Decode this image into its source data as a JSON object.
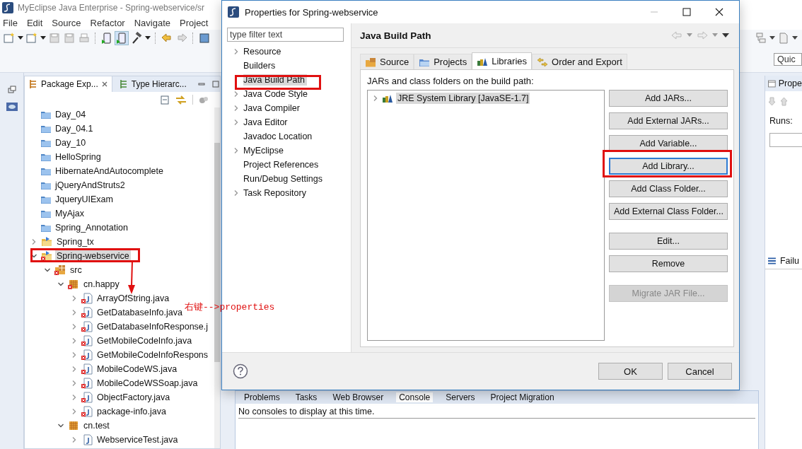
{
  "window": {
    "title": "MyEclipse Java Enterprise - Spring-webservice/sr"
  },
  "menu": [
    "File",
    "Edit",
    "Source",
    "Refactor",
    "Navigate",
    "Project"
  ],
  "quick_access": {
    "placeholder": "Quic"
  },
  "package_explorer": {
    "tabs": [
      {
        "label": "Package Exp...",
        "selected": true
      },
      {
        "label": "Type Hierarc...",
        "selected": false
      }
    ],
    "tree": [
      {
        "label": "Day_04",
        "kind": "closed-project",
        "selected": false
      },
      {
        "label": "Day_04.1",
        "kind": "closed-project",
        "selected": false
      },
      {
        "label": "Day_10",
        "kind": "closed-project",
        "selected": false
      },
      {
        "label": "HelloSpring",
        "kind": "closed-project",
        "selected": false
      },
      {
        "label": "HibernateAndAutocomplete",
        "kind": "closed-project",
        "selected": false
      },
      {
        "label": "jQueryAndStruts2",
        "kind": "closed-project",
        "selected": false
      },
      {
        "label": "JqueryUIExam",
        "kind": "closed-project",
        "selected": false
      },
      {
        "label": "MyAjax",
        "kind": "closed-project",
        "selected": false
      },
      {
        "label": "Spring_Annotation",
        "kind": "closed-project",
        "selected": false
      },
      {
        "label": "Spring_tx",
        "kind": "project",
        "expanded": false,
        "error": false,
        "selected": false
      },
      {
        "label": "Spring-webservice",
        "kind": "project",
        "expanded": true,
        "error": true,
        "selected": true,
        "children": [
          {
            "label": "src",
            "kind": "source-folder",
            "expanded": true,
            "error": true,
            "selected": false,
            "children": [
              {
                "label": "cn.happy",
                "kind": "package",
                "expanded": true,
                "error": true,
                "selected": false,
                "children": [
                  {
                    "label": "ArrayOfString.java",
                    "kind": "java-file",
                    "expanded": false,
                    "error": true,
                    "selected": false
                  },
                  {
                    "label": "GetDatabaseInfo.java",
                    "kind": "java-file",
                    "expanded": false,
                    "error": true,
                    "selected": false
                  },
                  {
                    "label": "GetDatabaseInfoResponse.j",
                    "kind": "java-file",
                    "expanded": false,
                    "error": true,
                    "selected": false
                  },
                  {
                    "label": "GetMobileCodeInfo.java",
                    "kind": "java-file",
                    "expanded": false,
                    "error": true,
                    "selected": false
                  },
                  {
                    "label": "GetMobileCodeInfoRespons",
                    "kind": "java-file",
                    "expanded": false,
                    "error": true,
                    "selected": false
                  },
                  {
                    "label": "MobileCodeWS.java",
                    "kind": "java-file",
                    "expanded": false,
                    "error": true,
                    "selected": false
                  },
                  {
                    "label": "MobileCodeWSSoap.java",
                    "kind": "java-file",
                    "expanded": false,
                    "error": true,
                    "selected": false
                  },
                  {
                    "label": "ObjectFactory.java",
                    "kind": "java-file",
                    "expanded": false,
                    "error": true,
                    "selected": false
                  },
                  {
                    "label": "package-info.java",
                    "kind": "java-file",
                    "expanded": false,
                    "error": true,
                    "selected": false
                  }
                ]
              },
              {
                "label": "cn.test",
                "kind": "package",
                "expanded": true,
                "error": false,
                "selected": false,
                "children": [
                  {
                    "label": "WebserviceTest.java",
                    "kind": "java-file",
                    "expanded": false,
                    "error": false,
                    "selected": false
                  }
                ]
              }
            ]
          }
        ]
      }
    ]
  },
  "right_panel": {
    "tab": "Prope",
    "runs_label": "Runs:",
    "failures_tab": "Failu"
  },
  "console": {
    "tabs": [
      {
        "label": "Problems",
        "selected": false
      },
      {
        "label": "Tasks",
        "selected": false
      },
      {
        "label": "Web Browser",
        "selected": false
      },
      {
        "label": "Console",
        "selected": true
      },
      {
        "label": "Servers",
        "selected": false
      },
      {
        "label": "Project Migration",
        "selected": false
      }
    ],
    "message": "No consoles to display at this time."
  },
  "dialog": {
    "title": "Properties for Spring-webservice",
    "filter": {
      "placeholder": "type filter text"
    },
    "categories": [
      {
        "label": "Resource",
        "expandable": true,
        "selected": false
      },
      {
        "label": "Builders",
        "expandable": false,
        "selected": false
      },
      {
        "label": "Java Build Path",
        "expandable": false,
        "selected": true
      },
      {
        "label": "Java Code Style",
        "expandable": true,
        "selected": false
      },
      {
        "label": "Java Compiler",
        "expandable": true,
        "selected": false
      },
      {
        "label": "Java Editor",
        "expandable": true,
        "selected": false
      },
      {
        "label": "Javadoc Location",
        "expandable": false,
        "selected": false
      },
      {
        "label": "MyEclipse",
        "expandable": true,
        "selected": false
      },
      {
        "label": "Project References",
        "expandable": false,
        "selected": false
      },
      {
        "label": "Run/Debug Settings",
        "expandable": false,
        "selected": false
      },
      {
        "label": "Task Repository",
        "expandable": true,
        "selected": false
      }
    ],
    "page_title": "Java Build Path",
    "tabs": [
      {
        "label": "Source",
        "selected": false
      },
      {
        "label": "Projects",
        "selected": false
      },
      {
        "label": "Libraries",
        "selected": true
      },
      {
        "label": "Order and Export",
        "selected": false
      }
    ],
    "list_label": "JARs and class folders on the build path:",
    "entries": [
      {
        "label": "JRE System Library [JavaSE-1.7]",
        "selected": true
      }
    ],
    "button_groups": [
      [
        {
          "label": "Add JARs...",
          "disabled": false,
          "focused": false
        },
        {
          "label": "Add External JARs...",
          "disabled": false,
          "focused": false
        },
        {
          "label": "Add Variable...",
          "disabled": false,
          "focused": false
        },
        {
          "label": "Add Library...",
          "disabled": false,
          "focused": true
        },
        {
          "label": "Add Class Folder...",
          "disabled": false,
          "focused": false
        },
        {
          "label": "Add External Class Folder...",
          "disabled": false,
          "focused": false
        }
      ],
      [
        {
          "label": "Edit...",
          "disabled": false,
          "focused": false
        },
        {
          "label": "Remove",
          "disabled": false,
          "focused": false
        }
      ],
      [
        {
          "label": "Migrate JAR File...",
          "disabled": true,
          "focused": false
        }
      ]
    ],
    "footer_buttons": [
      "OK",
      "Cancel"
    ]
  },
  "annotation": {
    "text": "右键-->properties"
  }
}
